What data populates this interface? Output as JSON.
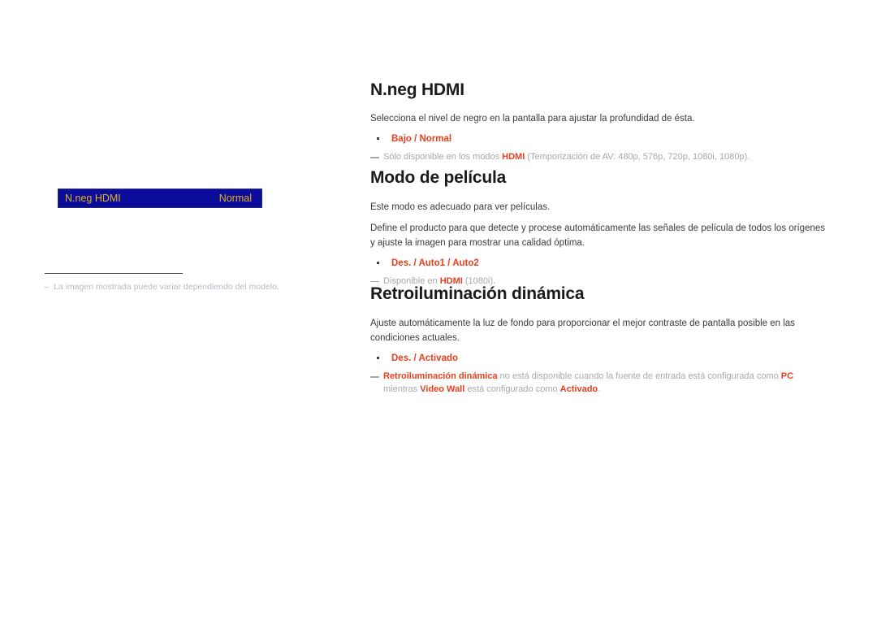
{
  "osd_widget": {
    "label": "N.neg HDMI",
    "value": "Normal",
    "bg_color": "#0b0b9c",
    "text_color": "#e0b318"
  },
  "left_footnote": {
    "dash": "‒",
    "text": "La imagen mostrada puede variar dependiendo del modelo."
  },
  "colors": {
    "accent_red": "#e8401f",
    "body_text": "#3b3b3b",
    "note_gray": "#a8a8a8",
    "heading": "#1a1a1a"
  },
  "sections": [
    {
      "title": "N.neg HDMI",
      "paragraphs": [
        "Selecciona el nivel de negro en la pantalla para ajustar la profundidad de ésta."
      ],
      "options": [
        "Bajo / Normal"
      ],
      "notes": [
        {
          "parts": [
            {
              "text": "Sólo disponible en los modos ",
              "style": "gray"
            },
            {
              "text": "HDMI",
              "style": "red"
            },
            {
              "text": " (Temporización de AV: 480p, 576p, 720p, 1080i, 1080p).",
              "style": "gray"
            }
          ]
        }
      ]
    },
    {
      "title": "Modo de película",
      "paragraphs": [
        "Este modo es adecuado para ver películas.",
        "Define el producto para que detecte y procese automáticamente las señales de película de todos los orígenes y ajuste la imagen para mostrar una calidad óptima."
      ],
      "options": [
        "Des. / Auto1 / Auto2"
      ],
      "notes": [
        {
          "parts": [
            {
              "text": "Disponible en ",
              "style": "gray"
            },
            {
              "text": "HDMI",
              "style": "red"
            },
            {
              "text": " (1080i).",
              "style": "gray"
            }
          ]
        }
      ]
    },
    {
      "title": "Retroiluminación dinámica",
      "paragraphs": [
        "Ajuste automáticamente la luz de fondo para proporcionar el mejor contraste de pantalla posible en las condiciones actuales."
      ],
      "options": [
        "Des. / Activado"
      ],
      "notes": [
        {
          "parts": [
            {
              "text": "Retroiluminación dinámica",
              "style": "red"
            },
            {
              "text": " no está disponible cuando la fuente de entrada está configurada como ",
              "style": "gray"
            },
            {
              "text": "PC",
              "style": "red"
            },
            {
              "text": " mientras ",
              "style": "gray"
            },
            {
              "text": "Video Wall",
              "style": "red"
            },
            {
              "text": " está configurado como ",
              "style": "gray"
            },
            {
              "text": "Activado",
              "style": "red"
            },
            {
              "text": ".",
              "style": "gray"
            }
          ]
        }
      ]
    }
  ]
}
